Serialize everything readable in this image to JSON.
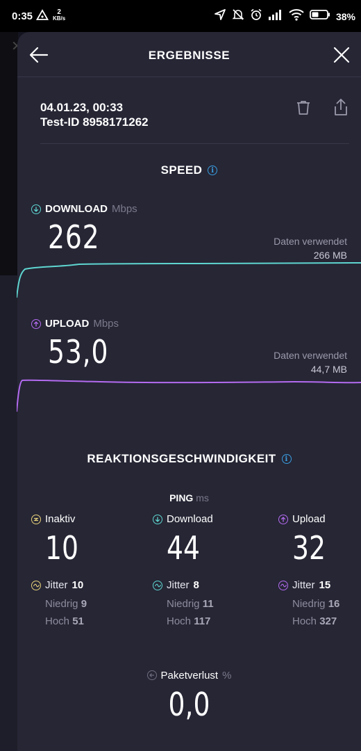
{
  "status_bar": {
    "time": "0:35",
    "data_rate_value": "2",
    "data_rate_unit": "KB/s",
    "battery": "38%"
  },
  "header": {
    "title": "ERGEBNISSE"
  },
  "test": {
    "date": "04.01.23, 00:33",
    "test_id": "Test-ID 8958171262"
  },
  "speed": {
    "title": "SPEED",
    "download": {
      "label": "DOWNLOAD",
      "unit": "Mbps",
      "value": "262",
      "data_used_label": "Daten verwendet",
      "data_used": "266 MB",
      "color": "#5fd6d0"
    },
    "upload": {
      "label": "UPLOAD",
      "unit": "Mbps",
      "value": "53,0",
      "data_used_label": "Daten verwendet",
      "data_used": "44,7 MB",
      "color": "#b46bf0"
    }
  },
  "latency": {
    "title": "REAKTIONSGESCHWINDIGKEIT",
    "ping_label": "PING",
    "ping_unit": "ms",
    "columns": [
      {
        "label": "Inaktiv",
        "value": "10",
        "jitter_label": "Jitter",
        "jitter": "10",
        "low_label": "Niedrig",
        "low": "9",
        "high_label": "Hoch",
        "high": "51",
        "color": "#e8d27a"
      },
      {
        "label": "Download",
        "value": "44",
        "jitter_label": "Jitter",
        "jitter": "8",
        "low_label": "Niedrig",
        "low": "11",
        "high_label": "Hoch",
        "high": "117",
        "color": "#5fd6d0"
      },
      {
        "label": "Upload",
        "value": "32",
        "jitter_label": "Jitter",
        "jitter": "15",
        "low_label": "Niedrig",
        "low": "16",
        "high_label": "Hoch",
        "high": "327",
        "color": "#b46bf0"
      }
    ],
    "packet_loss_label": "Paketverlust",
    "packet_loss_unit": "%",
    "packet_loss": "0,0"
  },
  "colors": {
    "accent_info": "#3a9de0",
    "sheet_bg": "#262635"
  },
  "icons": [
    "back-arrow-icon",
    "close-icon",
    "trash-icon",
    "share-icon",
    "info-icon",
    "download-arrow-icon",
    "upload-arrow-icon",
    "idle-icon",
    "jitter-icon",
    "packet-loss-icon"
  ]
}
